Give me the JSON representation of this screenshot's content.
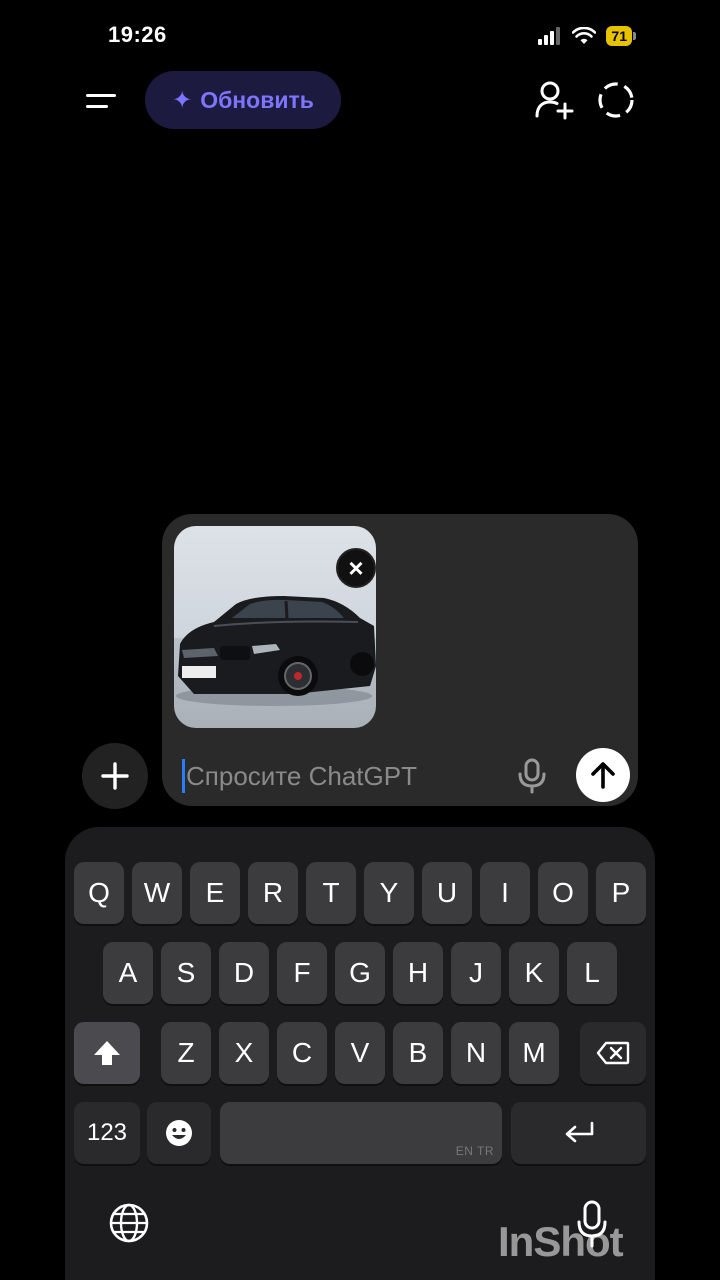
{
  "status_bar": {
    "time": "19:26",
    "battery": "71"
  },
  "header": {
    "upgrade_label": "Обновить"
  },
  "composer": {
    "placeholder": "Спросите ChatGPT"
  },
  "keyboard": {
    "row1": [
      "Q",
      "W",
      "E",
      "R",
      "T",
      "Y",
      "U",
      "I",
      "O",
      "P"
    ],
    "row2": [
      "A",
      "S",
      "D",
      "F",
      "G",
      "H",
      "J",
      "K",
      "L"
    ],
    "row3": [
      "Z",
      "X",
      "C",
      "V",
      "B",
      "N",
      "M"
    ],
    "numbers_label": "123",
    "space_hint": "EN TR"
  },
  "watermark": "InShot"
}
